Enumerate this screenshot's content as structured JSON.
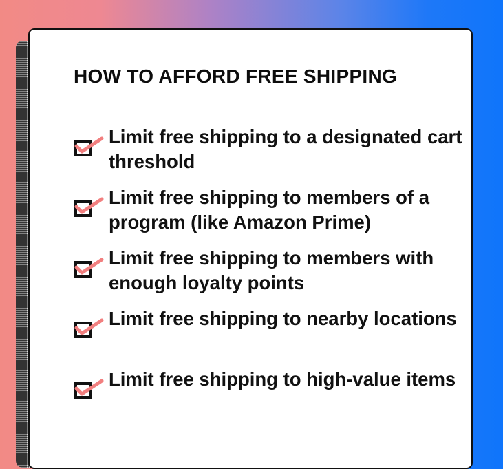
{
  "title": "HOW TO AFFORD FREE SHIPPING",
  "colors": {
    "check": "#f27f7f",
    "box": "#111111",
    "background_left": "#f28a85",
    "background_right": "#0f75fb"
  },
  "items": [
    {
      "icon": "checked-box-icon",
      "text": "Limit free shipping to a designated cart threshold"
    },
    {
      "icon": "checked-box-icon",
      "text": "Limit free shipping to members of a program (like Amazon Prime)"
    },
    {
      "icon": "checked-box-icon",
      "text": "Limit free shipping to members with enough loyalty points"
    },
    {
      "icon": "checked-box-icon",
      "text": "Limit free shipping to nearby locations"
    },
    {
      "icon": "checked-box-icon",
      "text": "Limit free shipping to high-value items"
    }
  ]
}
